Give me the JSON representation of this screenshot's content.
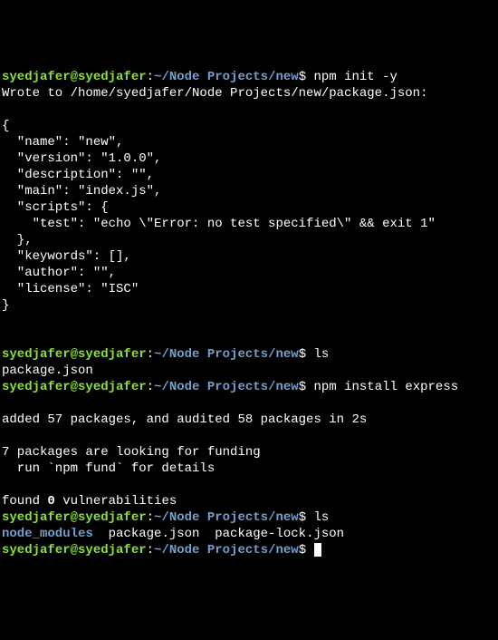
{
  "prompts": [
    {
      "user": "syedjafer@syedjafer",
      "colon": ":",
      "path": "~/Node Projects/new",
      "dollar": "$ ",
      "cmd": "npm init -y"
    },
    {
      "user": "syedjafer@syedjafer",
      "colon": ":",
      "path": "~/Node Projects/new",
      "dollar": "$ ",
      "cmd": "ls"
    },
    {
      "user": "syedjafer@syedjafer",
      "colon": ":",
      "path": "~/Node Projects/new",
      "dollar": "$ ",
      "cmd": "npm install express"
    },
    {
      "user": "syedjafer@syedjafer",
      "colon": ":",
      "path": "~/Node Projects/new",
      "dollar": "$ ",
      "cmd": "ls"
    },
    {
      "user": "syedjafer@syedjafer",
      "colon": ":",
      "path": "~/Node Projects/new",
      "dollar": "$ ",
      "cmd": ""
    }
  ],
  "output": {
    "wrote": "Wrote to /home/syedjafer/Node Projects/new/package.json:",
    "json_open": "{",
    "json_name": "  \"name\": \"new\",",
    "json_version": "  \"version\": \"1.0.0\",",
    "json_desc": "  \"description\": \"\",",
    "json_main": "  \"main\": \"index.js\",",
    "json_scripts": "  \"scripts\": {",
    "json_test": "    \"test\": \"echo \\\"Error: no test specified\\\" && exit 1\"",
    "json_scripts_close": "  },",
    "json_keywords": "  \"keywords\": [],",
    "json_author": "  \"author\": \"\",",
    "json_license": "  \"license\": \"ISC\"",
    "json_close": "}",
    "ls1": "package.json",
    "added": "added 57 packages, and audited 58 packages in 2s",
    "funding1": "7 packages are looking for funding",
    "funding2": "  run `npm fund` for details",
    "found_prefix": "found ",
    "found_zero": "0",
    "found_suffix": " vulnerabilities",
    "ls2_dir": "node_modules",
    "ls2_rest": "  package.json  package-lock.json"
  }
}
